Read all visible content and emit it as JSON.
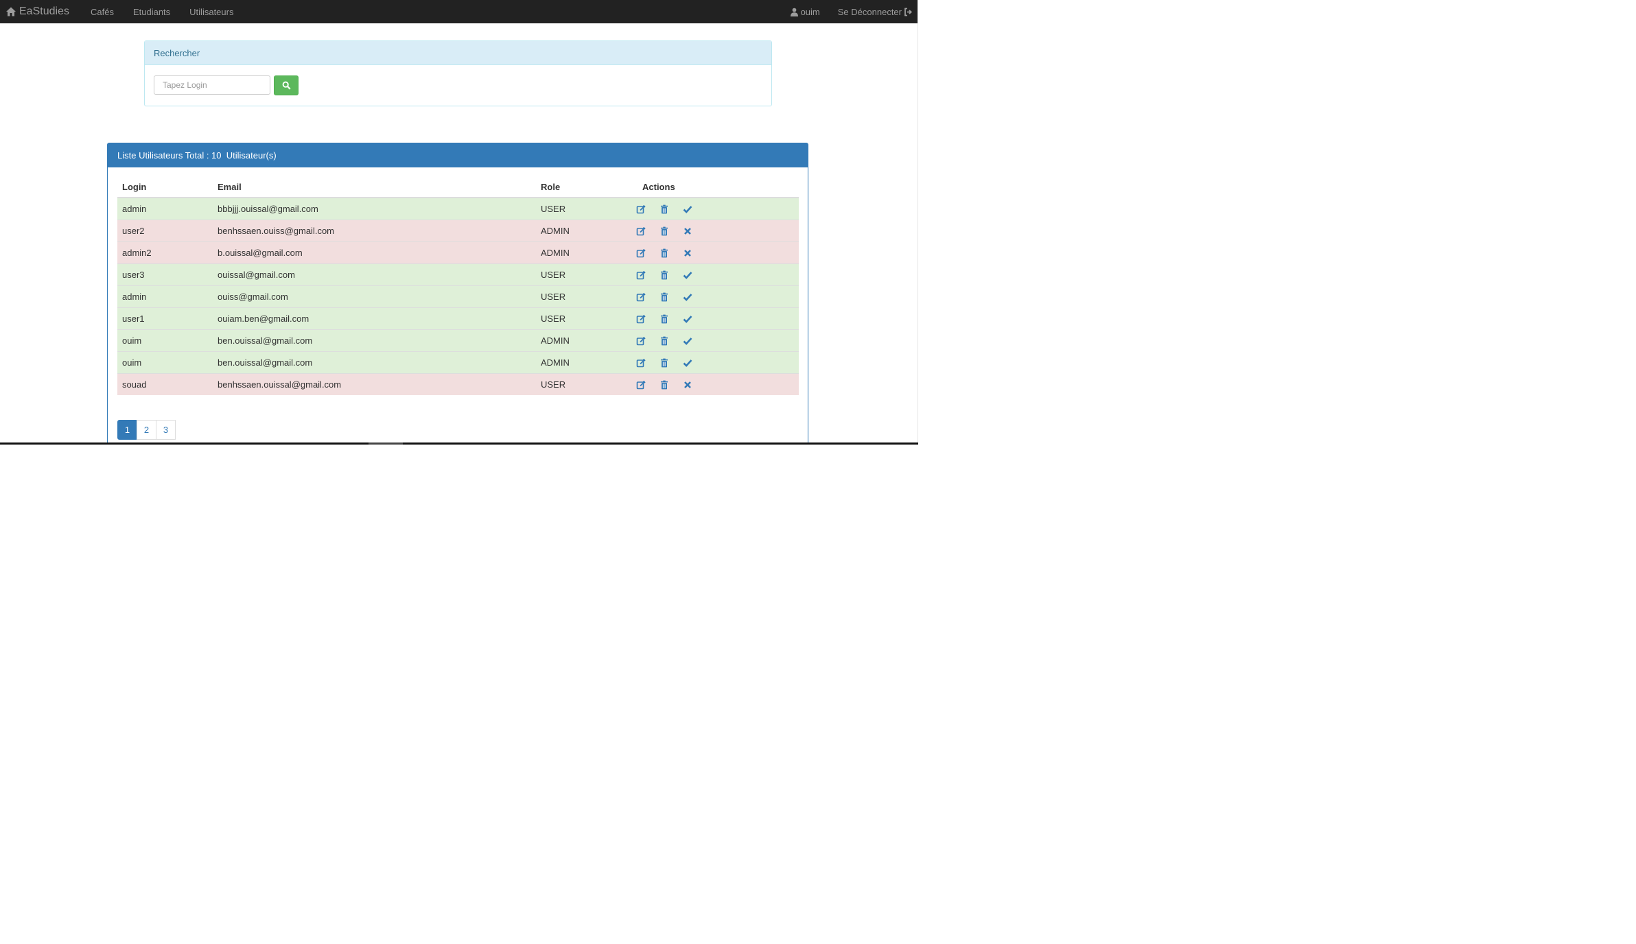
{
  "navbar": {
    "brand": "EaStudies",
    "links": [
      "Cafés",
      "Etudiants",
      "Utilisateurs"
    ],
    "user": "ouim",
    "logout": "Se Déconnecter"
  },
  "search": {
    "title": "Rechercher",
    "placeholder": "Tapez Login"
  },
  "users_panel": {
    "title": "Liste Utilisateurs Total : 10  Utilisateur(s)",
    "columns": [
      "Login",
      "Email",
      "Role",
      "Actions"
    ],
    "rows": [
      {
        "login": "admin",
        "email": "bbbjjj.ouissal@gmail.com",
        "role": "USER",
        "status": "active"
      },
      {
        "login": "user2",
        "email": "benhssaen.ouiss@gmail.com",
        "role": "ADMIN",
        "status": "inactive"
      },
      {
        "login": "admin2",
        "email": "b.ouissal@gmail.com",
        "role": "ADMIN",
        "status": "inactive"
      },
      {
        "login": "user3",
        "email": "ouissal@gmail.com",
        "role": "USER",
        "status": "active"
      },
      {
        "login": "admin",
        "email": "ouiss@gmail.com",
        "role": "USER",
        "status": "active"
      },
      {
        "login": "user1",
        "email": "ouiam.ben@gmail.com",
        "role": "USER",
        "status": "active"
      },
      {
        "login": "ouim",
        "email": "ben.ouissal@gmail.com",
        "role": "ADMIN",
        "status": "active"
      },
      {
        "login": "ouim",
        "email": "ben.ouissal@gmail.com",
        "role": "ADMIN",
        "status": "active"
      },
      {
        "login": "souad",
        "email": "benhssaen.ouissal@gmail.com",
        "role": "USER",
        "status": "inactive"
      }
    ]
  },
  "pagination": {
    "pages": [
      "1",
      "2",
      "3"
    ],
    "current": "1"
  },
  "colors": {
    "navbar": "#222222",
    "primary": "#337ab7",
    "success_row": "#dff0d8",
    "danger_row": "#f2dede",
    "search_button": "#5cb85c",
    "info_header": "#d9edf7"
  },
  "icons": {
    "brand": "home-icon",
    "user": "user-icon",
    "logout": "logout-icon",
    "search": "search-icon",
    "edit": "edit-icon",
    "delete": "trash-icon",
    "active": "check-icon",
    "inactive": "remove-icon"
  }
}
